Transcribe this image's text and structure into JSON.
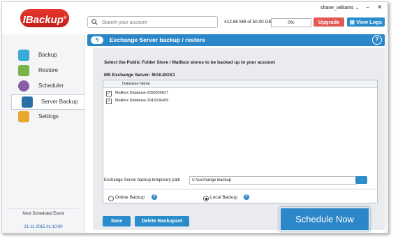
{
  "brand": {
    "logo_text": "IBackup"
  },
  "user": {
    "name": "shane_williams ⌄"
  },
  "search": {
    "placeholder": "Search your account"
  },
  "usage": {
    "text": "412.86 MB of 50.00 GB used",
    "percent_text": "0%"
  },
  "top_buttons": {
    "upgrade": "Upgrade",
    "view_logs": "View Logs"
  },
  "window_controls": {
    "minimize": "–",
    "close": "✕"
  },
  "sidebar": {
    "items": [
      {
        "label": "Backup",
        "icon": "upload-cloud-icon",
        "color": "#3aaad8"
      },
      {
        "label": "Restore",
        "icon": "download-cloud-icon",
        "color": "#7bb349"
      },
      {
        "label": "Scheduler",
        "icon": "clock-icon",
        "color": "#8b5ca8"
      },
      {
        "label": "Server Backup",
        "icon": "server-icon",
        "color": "#2b6fa8"
      },
      {
        "label": "Settings",
        "icon": "gear-icon",
        "color": "#e8a72e"
      }
    ],
    "active": "Server Backup",
    "next_event_label": "Next Scheduled Event",
    "next_event_date": "21-11-2015 01:10:00"
  },
  "header": {
    "title": "Exchange Server backup / restore",
    "help": "?",
    "back": "↰"
  },
  "content": {
    "instruction": "Select the Public Folder Store / Mailbox stores to be backed up to your account",
    "server_label": "MS Exchange Server: MAILBOX1",
    "table": {
      "column": "Database Name",
      "rows": [
        {
          "name": "Mailbox Database 2099326627",
          "checked": true
        },
        {
          "name": "Mailbox Database 2043336409",
          "checked": true
        }
      ]
    },
    "path_label": "Exchange Server backup temporary path",
    "path_value": "C:\\Exchange Backup",
    "browse": "...",
    "options": [
      {
        "label": "Online Backup",
        "selected": false
      },
      {
        "label": "Local Backup",
        "selected": true
      }
    ],
    "save": "Save",
    "delete": "Delete Backupset"
  },
  "schedule_button": "Schedule Now",
  "colors": {
    "accent": "#2b87c7",
    "upgrade": "#e15a56"
  }
}
